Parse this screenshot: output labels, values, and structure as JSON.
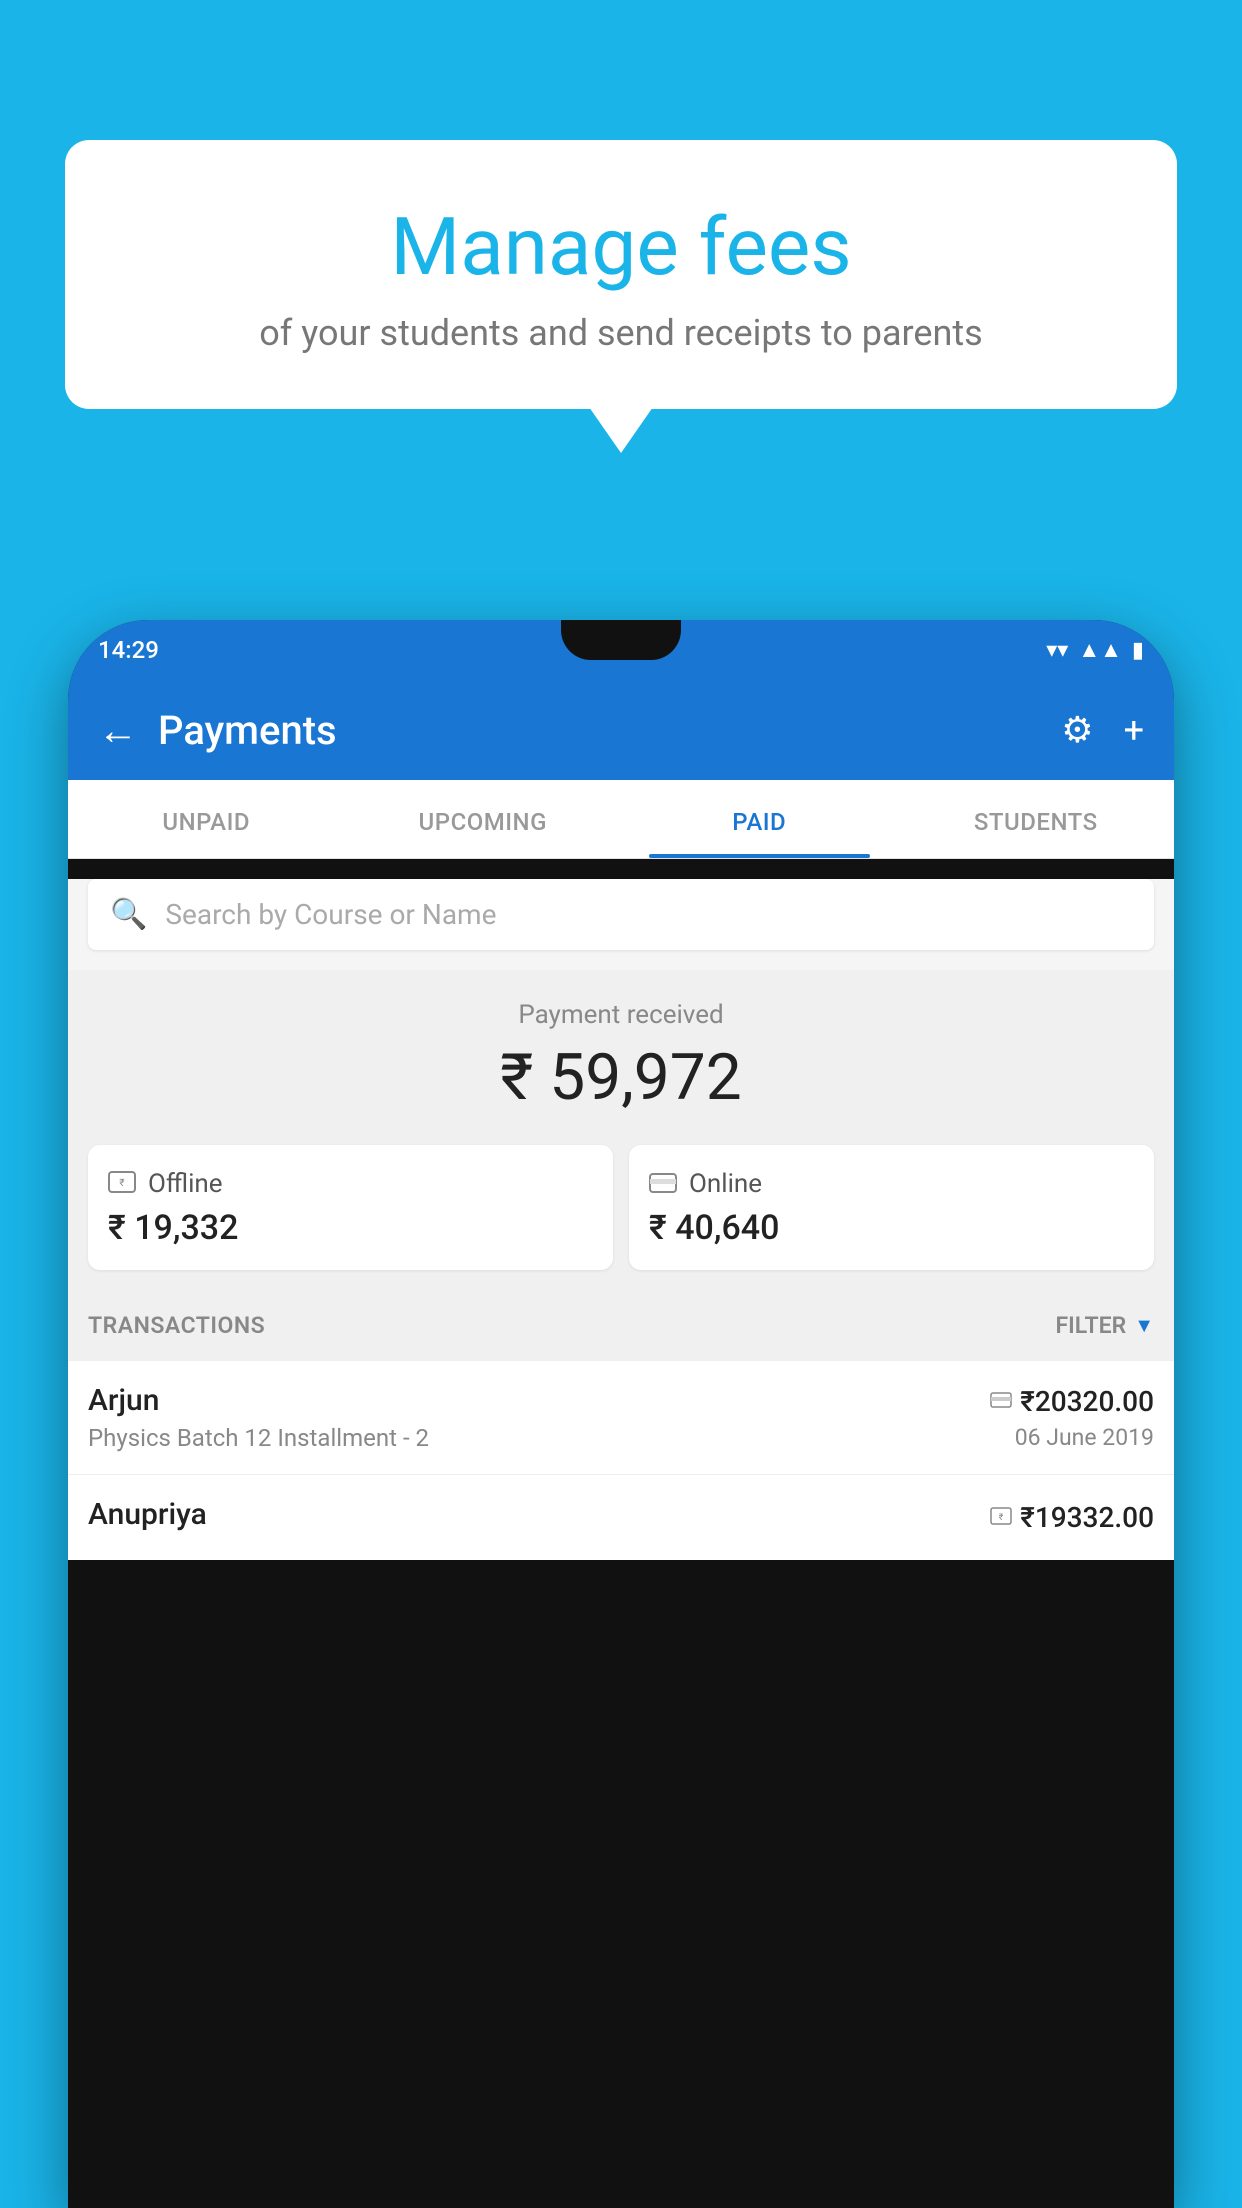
{
  "background_color": "#1ab4e8",
  "hero": {
    "title": "Manage fees",
    "subtitle": "of your students and send receipts to parents"
  },
  "status_bar": {
    "time": "14:29",
    "icons": [
      "wifi",
      "signal",
      "battery"
    ]
  },
  "header": {
    "title": "Payments",
    "back_label": "←",
    "settings_label": "⚙",
    "add_label": "+"
  },
  "tabs": [
    {
      "label": "UNPAID",
      "active": false
    },
    {
      "label": "UPCOMING",
      "active": false
    },
    {
      "label": "PAID",
      "active": true
    },
    {
      "label": "STUDENTS",
      "active": false
    }
  ],
  "search": {
    "placeholder": "Search by Course or Name"
  },
  "payment_summary": {
    "label": "Payment received",
    "amount": "₹ 59,972",
    "offline": {
      "type": "Offline",
      "amount": "₹ 19,332"
    },
    "online": {
      "type": "Online",
      "amount": "₹ 40,640"
    }
  },
  "transactions_section": {
    "label": "TRANSACTIONS",
    "filter_label": "FILTER"
  },
  "transactions": [
    {
      "name": "Arjun",
      "course": "Physics Batch 12 Installment - 2",
      "amount": "₹20320.00",
      "date": "06 June 2019",
      "icon": "card"
    },
    {
      "name": "Anupriya",
      "amount": "₹19332.00",
      "icon": "cash"
    }
  ]
}
